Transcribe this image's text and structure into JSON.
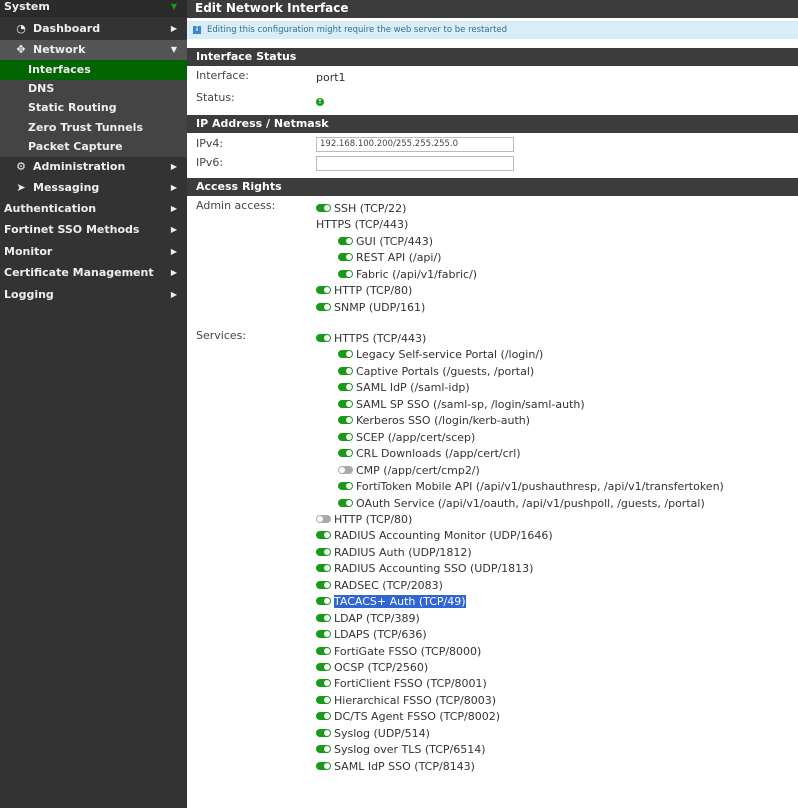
{
  "sidebar": {
    "system": "System",
    "items": [
      {
        "label": "Dashboard",
        "icon": "dashboard-icon",
        "glyph": "◔"
      },
      {
        "label": "Network",
        "icon": "network-move-icon",
        "glyph": "✥"
      },
      {
        "label": "Administration",
        "icon": "gear-icon",
        "glyph": "⚙"
      },
      {
        "label": "Messaging",
        "icon": "paper-plane-icon",
        "glyph": "➤"
      }
    ],
    "network_sub": [
      "Interfaces",
      "DNS",
      "Static Routing",
      "Zero Trust Tunnels",
      "Packet Capture"
    ],
    "top": [
      "Authentication",
      "Fortinet SSO Methods",
      "Monitor",
      "Certificate Management",
      "Logging"
    ]
  },
  "page": {
    "title": "Edit Network Interface",
    "info": "Editing this configuration might require the web server to be restarted",
    "interface_status": "Interface Status",
    "interface_label": "Interface:",
    "interface_value": "port1",
    "status_label": "Status:",
    "ip_section": "IP Address / Netmask",
    "ipv4_label": "IPv4:",
    "ipv4_value": "192.168.100.200/255.255.255.0",
    "ipv6_label": "IPv6:",
    "ipv6_value": "",
    "access_rights": "Access Rights",
    "admin_label": "Admin access:",
    "services_label": "Services:"
  },
  "admin_access": [
    {
      "label": "SSH (TCP/22)",
      "on": true,
      "indent": 0
    },
    {
      "label": "HTTPS (TCP/443)",
      "on": null,
      "indent": 0
    },
    {
      "label": "GUI (TCP/443)",
      "on": true,
      "indent": 1
    },
    {
      "label": "REST API (/api/)",
      "on": true,
      "indent": 1
    },
    {
      "label": "Fabric (/api/v1/fabric/)",
      "on": true,
      "indent": 1
    },
    {
      "label": "HTTP (TCP/80)",
      "on": true,
      "indent": 0
    },
    {
      "label": "SNMP (UDP/161)",
      "on": true,
      "indent": 0
    }
  ],
  "services": [
    {
      "label": "HTTPS (TCP/443)",
      "on": true,
      "indent": 0
    },
    {
      "label": "Legacy Self-service Portal (/login/)",
      "on": true,
      "indent": 1
    },
    {
      "label": "Captive Portals (/guests, /portal)",
      "on": true,
      "indent": 1
    },
    {
      "label": "SAML IdP (/saml-idp)",
      "on": true,
      "indent": 1
    },
    {
      "label": "SAML SP SSO (/saml-sp, /login/saml-auth)",
      "on": true,
      "indent": 1
    },
    {
      "label": "Kerberos SSO (/login/kerb-auth)",
      "on": true,
      "indent": 1
    },
    {
      "label": "SCEP (/app/cert/scep)",
      "on": true,
      "indent": 1
    },
    {
      "label": "CRL Downloads (/app/cert/crl)",
      "on": true,
      "indent": 1
    },
    {
      "label": "CMP (/app/cert/cmp2/)",
      "on": false,
      "indent": 1
    },
    {
      "label": "FortiToken Mobile API (/api/v1/pushauthresp, /api/v1/transfertoken)",
      "on": true,
      "indent": 1
    },
    {
      "label": "OAuth Service (/api/v1/oauth, /api/v1/pushpoll, /guests, /portal)",
      "on": true,
      "indent": 1
    },
    {
      "label": "HTTP (TCP/80)",
      "on": false,
      "indent": 0
    },
    {
      "label": "RADIUS Accounting Monitor (UDP/1646)",
      "on": true,
      "indent": 0
    },
    {
      "label": "RADIUS Auth (UDP/1812)",
      "on": true,
      "indent": 0
    },
    {
      "label": "RADIUS Accounting SSO (UDP/1813)",
      "on": true,
      "indent": 0
    },
    {
      "label": "RADSEC (TCP/2083)",
      "on": true,
      "indent": 0
    },
    {
      "label": "TACACS+ Auth (TCP/49)",
      "on": true,
      "indent": 0,
      "selected": true
    },
    {
      "label": "LDAP (TCP/389)",
      "on": true,
      "indent": 0
    },
    {
      "label": "LDAPS (TCP/636)",
      "on": true,
      "indent": 0
    },
    {
      "label": "FortiGate FSSO (TCP/8000)",
      "on": true,
      "indent": 0
    },
    {
      "label": "OCSP (TCP/2560)",
      "on": true,
      "indent": 0
    },
    {
      "label": "FortiClient FSSO (TCP/8001)",
      "on": true,
      "indent": 0
    },
    {
      "label": "Hierarchical FSSO (TCP/8003)",
      "on": true,
      "indent": 0
    },
    {
      "label": "DC/TS Agent FSSO (TCP/8002)",
      "on": true,
      "indent": 0
    },
    {
      "label": "Syslog (UDP/514)",
      "on": true,
      "indent": 0
    },
    {
      "label": "Syslog over TLS (TCP/6514)",
      "on": true,
      "indent": 0
    },
    {
      "label": "SAML IdP SSO (TCP/8143)",
      "on": true,
      "indent": 0
    }
  ]
}
